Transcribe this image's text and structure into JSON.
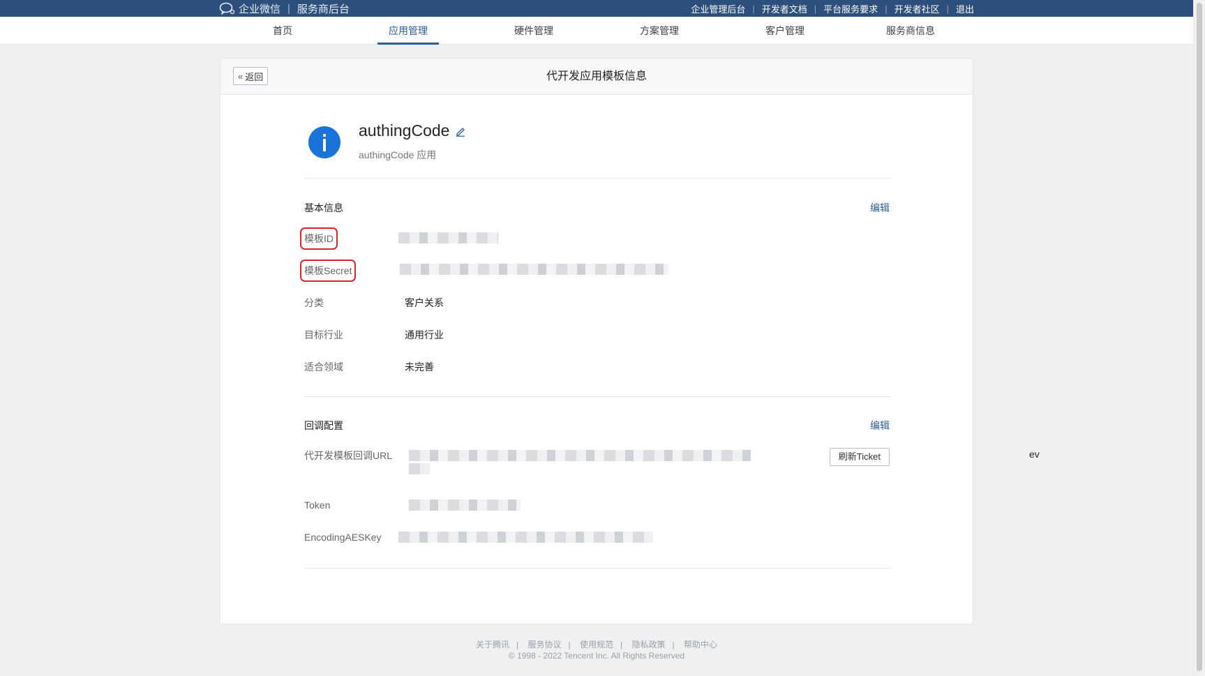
{
  "topbar": {
    "brand": "企业微信",
    "subbrand": "服务商后台",
    "links": [
      "企业管理后台",
      "开发者文档",
      "平台服务要求",
      "开发者社区",
      "退出"
    ]
  },
  "nav": {
    "items": [
      "首页",
      "应用管理",
      "硬件管理",
      "方案管理",
      "客户管理",
      "服务商信息"
    ],
    "active": "应用管理"
  },
  "card": {
    "back_label": "返回",
    "title": "代开发应用模板信息"
  },
  "app": {
    "name": "authingCode",
    "desc": "authingCode 应用",
    "icon": "info-icon",
    "icon_color": "#1a73d9"
  },
  "basic": {
    "title": "基本信息",
    "edit_label": "编辑",
    "rows": {
      "template_id": "模板ID",
      "template_secret": "模板Secret",
      "category": "分类",
      "category_value": "客户关系",
      "industry": "目标行业",
      "industry_value": "通用行业",
      "domain": "适合领域",
      "domain_value": "未完善"
    }
  },
  "callback": {
    "title": "回调配置",
    "edit_label": "编辑",
    "url_label": "代开发模板回调URL",
    "url_tail": "ev",
    "refresh_label": "刷新Ticket",
    "token_label": "Token",
    "aes_label": "EncodingAESKey"
  },
  "footer": {
    "links": [
      "关于腾讯",
      "服务协议",
      "使用规范",
      "隐私政策",
      "帮助中心"
    ],
    "copyright": "© 1998 - 2022 Tencent Inc. All Rights Reserved"
  },
  "colors": {
    "topbar": "#2c4f7c",
    "accent": "#2a5d9b",
    "highlight": "#d9252b"
  }
}
